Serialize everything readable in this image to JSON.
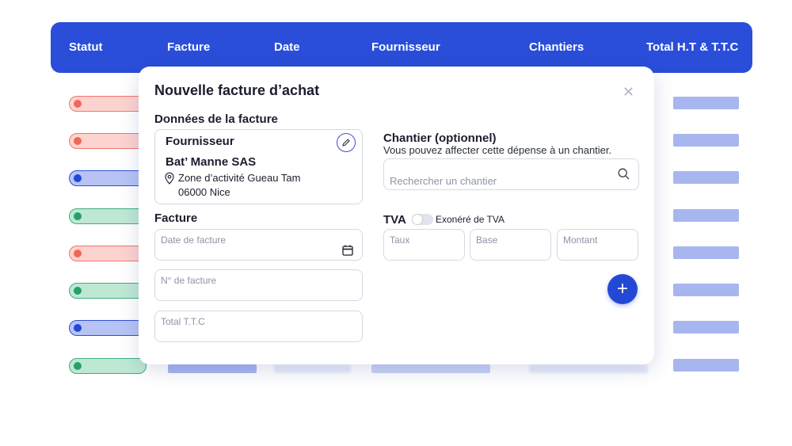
{
  "table": {
    "headers": [
      "Statut",
      "Facture",
      "Date",
      "Fournisseur",
      "Chantiers",
      "Total H.T & T.T.C"
    ],
    "rows": [
      {
        "status": "red"
      },
      {
        "status": "red"
      },
      {
        "status": "blue"
      },
      {
        "status": "green"
      },
      {
        "status": "red"
      },
      {
        "status": "green"
      },
      {
        "status": "blue"
      },
      {
        "status": "green"
      }
    ]
  },
  "colors": {
    "header_bg": "#2a4ed9",
    "status_red": {
      "bg": "#fdd3d0",
      "border": "#f0766c",
      "dot": "#f0675b"
    },
    "status_blue": {
      "bg": "#b7c3f5",
      "border": "#2d4fd4",
      "dot": "#2447d6"
    },
    "status_green": {
      "bg": "#bfe8d4",
      "border": "#3bb07c",
      "dot": "#26a06a"
    },
    "accent": "#2349d4"
  },
  "modal": {
    "title": "Nouvelle facture d’achat",
    "close_icon": "close-icon",
    "invoice_data_title": "Données de la facture",
    "supplier": {
      "title": "Fournisseur",
      "name": "Bat’ Manne SAS",
      "address_line1": "Zone d’activité Gueau Tam",
      "address_line2": "06000 Nice",
      "edit_icon": "pencil-icon",
      "location_icon": "location-pin-icon"
    },
    "invoice_section": {
      "title": "Facture",
      "date_placeholder": "Date de facture",
      "calendar_icon": "calendar-icon",
      "number_placeholder": "N° de facture",
      "total_placeholder": "Total T.T.C"
    },
    "chantier": {
      "title": "Chantier (optionnel)",
      "helper": "Vous pouvez affecter cette dépense à un chantier.",
      "search_placeholder": "Rechercher un chantier",
      "search_icon": "search-icon"
    },
    "tva": {
      "title": "TVA",
      "toggle_label": "Exonéré de TVA",
      "toggle_on": false,
      "rate_placeholder": "Taux",
      "base_placeholder": "Base",
      "amount_placeholder": "Montant"
    },
    "add_button": "+"
  }
}
